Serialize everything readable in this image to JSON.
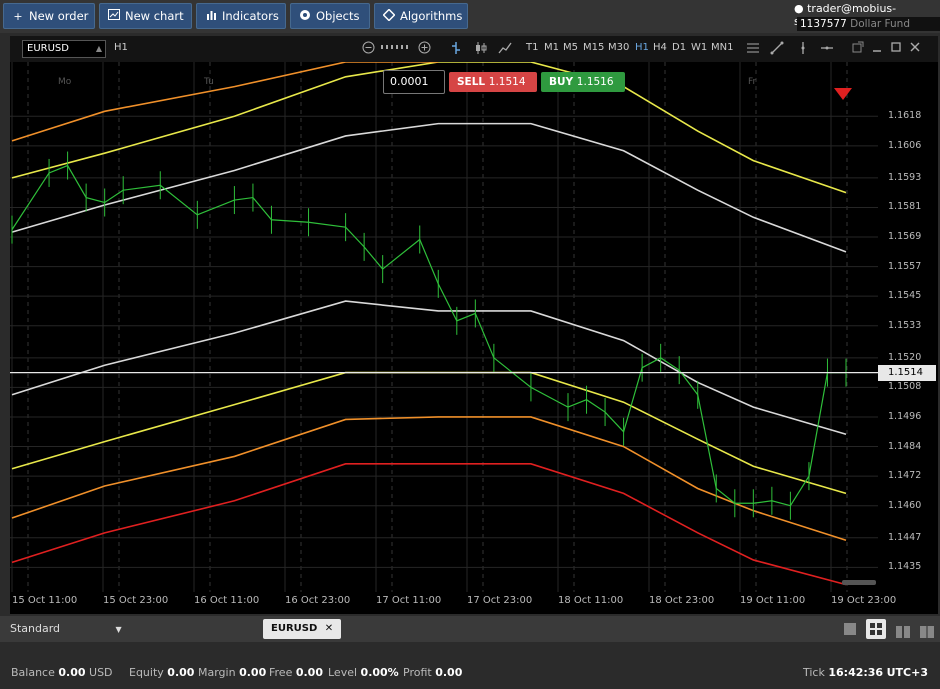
{
  "toolbar": {
    "new_order": "New order",
    "new_chart": "New chart",
    "indicators": "Indicators",
    "objects": "Objects",
    "algorithms": "Algorithms"
  },
  "account": {
    "user": "trader@mobius-soft.org",
    "number": "1137577",
    "fund": "Dollar Fund"
  },
  "chart_toolbar": {
    "symbol": "EURUSD",
    "timeframe": "H1",
    "periods": [
      "T1",
      "M1",
      "M5",
      "M15",
      "M30",
      "H1",
      "H4",
      "D1",
      "W1",
      "MN1"
    ],
    "active_period": "H1"
  },
  "trade": {
    "lot": "0.0001",
    "sell_label": "SELL",
    "sell_price": "1.1514",
    "buy_label": "BUY",
    "buy_price": "1.1516"
  },
  "chart_data": {
    "type": "line",
    "symbol": "EURUSD",
    "timeframe": "H1",
    "current_price": "1.1514",
    "y_ticks": [
      "1.1618",
      "1.1606",
      "1.1593",
      "1.1581",
      "1.1569",
      "1.1557",
      "1.1545",
      "1.1533",
      "1.1520",
      "1.1508",
      "1.1496",
      "1.1484",
      "1.1472",
      "1.1460",
      "1.1447",
      "1.1435"
    ],
    "x_ticks": [
      "15 Oct 11:00",
      "15 Oct 23:00",
      "16 Oct 11:00",
      "16 Oct 23:00",
      "17 Oct 11:00",
      "17 Oct 23:00",
      "18 Oct 11:00",
      "18 Oct 23:00",
      "19 Oct 11:00",
      "19 Oct 23:00"
    ],
    "day_labels": [
      "Mo",
      "Tu",
      "Fr"
    ],
    "ylim": [
      1.1425,
      1.164
    ],
    "series": [
      {
        "color": "#e8e84a",
        "x": [
          0,
          5,
          12,
          18,
          23,
          28,
          33,
          37,
          40,
          45
        ],
        "y": [
          1.1593,
          1.1603,
          1.1618,
          1.1634,
          1.164,
          1.164,
          1.163,
          1.1612,
          1.16,
          1.1587
        ]
      },
      {
        "color": "#d9d9d9",
        "x": [
          0,
          5,
          12,
          18,
          23,
          28,
          33,
          37,
          40,
          45
        ],
        "y": [
          1.1571,
          1.1582,
          1.1596,
          1.161,
          1.1615,
          1.1615,
          1.1604,
          1.1588,
          1.1577,
          1.1563
        ]
      },
      {
        "color": "#f0902a",
        "x": [
          0,
          5,
          12,
          18,
          23
        ],
        "y": [
          1.1608,
          1.162,
          1.163,
          1.164,
          1.164
        ]
      },
      {
        "color": "#d9d9d9",
        "x": [
          0,
          5,
          12,
          18,
          23,
          28,
          33,
          37,
          40,
          45
        ],
        "y": [
          1.1505,
          1.1517,
          1.153,
          1.1543,
          1.1539,
          1.1539,
          1.1527,
          1.151,
          1.15,
          1.1489
        ]
      },
      {
        "color": "#e8e84a",
        "x": [
          0,
          5,
          12,
          18,
          23,
          28,
          33,
          37,
          40,
          45
        ],
        "y": [
          1.1475,
          1.1486,
          1.1501,
          1.1514,
          1.1514,
          1.1514,
          1.1502,
          1.1487,
          1.1476,
          1.1465
        ]
      },
      {
        "color": "#f0902a",
        "x": [
          0,
          5,
          12,
          18,
          23,
          28,
          33,
          37,
          40,
          45
        ],
        "y": [
          1.1455,
          1.1468,
          1.148,
          1.1495,
          1.1496,
          1.1496,
          1.1484,
          1.1467,
          1.1458,
          1.1446
        ]
      },
      {
        "color": "#e02020",
        "x": [
          0,
          5,
          12,
          18,
          23,
          28,
          33,
          37,
          40,
          45
        ],
        "y": [
          1.1437,
          1.1449,
          1.1462,
          1.1477,
          1.1477,
          1.1477,
          1.1465,
          1.1449,
          1.1438,
          1.1428
        ]
      },
      {
        "color": "#2fbf3a",
        "x": [
          0,
          2,
          3,
          4,
          5,
          6,
          8,
          10,
          12,
          13,
          14,
          16,
          18,
          19,
          20,
          22,
          23,
          24,
          25,
          26,
          28,
          30,
          31,
          32,
          33,
          34,
          35,
          36,
          37,
          38,
          39,
          40,
          41,
          42,
          43,
          44,
          45
        ],
        "y": [
          1.1572,
          1.1595,
          1.1598,
          1.1585,
          1.1583,
          1.1588,
          1.159,
          1.1578,
          1.1584,
          1.1585,
          1.1576,
          1.1575,
          1.1573,
          1.1565,
          1.1556,
          1.1568,
          1.155,
          1.1535,
          1.1538,
          1.152,
          1.1508,
          1.15,
          1.1503,
          1.1498,
          1.149,
          1.1516,
          1.152,
          1.1515,
          1.1505,
          1.1467,
          1.1461,
          1.1461,
          1.1462,
          1.146,
          1.1472,
          1.1514,
          1.1514
        ]
      }
    ]
  },
  "bottom": {
    "layout": "Standard",
    "tab": "EURUSD"
  },
  "status": {
    "balance_label": "Balance",
    "balance": "0.00",
    "currency": "USD",
    "equity_label": "Equity",
    "equity": "0.00",
    "margin_label": "Margin",
    "margin": "0.00",
    "free_label": "Free",
    "free": "0.00",
    "level_label": "Level",
    "level": "0.00%",
    "profit_label": "Profit",
    "profit": "0.00",
    "tick_label": "Tick",
    "tick": "16:42:36",
    "timezone": "UTC+3"
  }
}
